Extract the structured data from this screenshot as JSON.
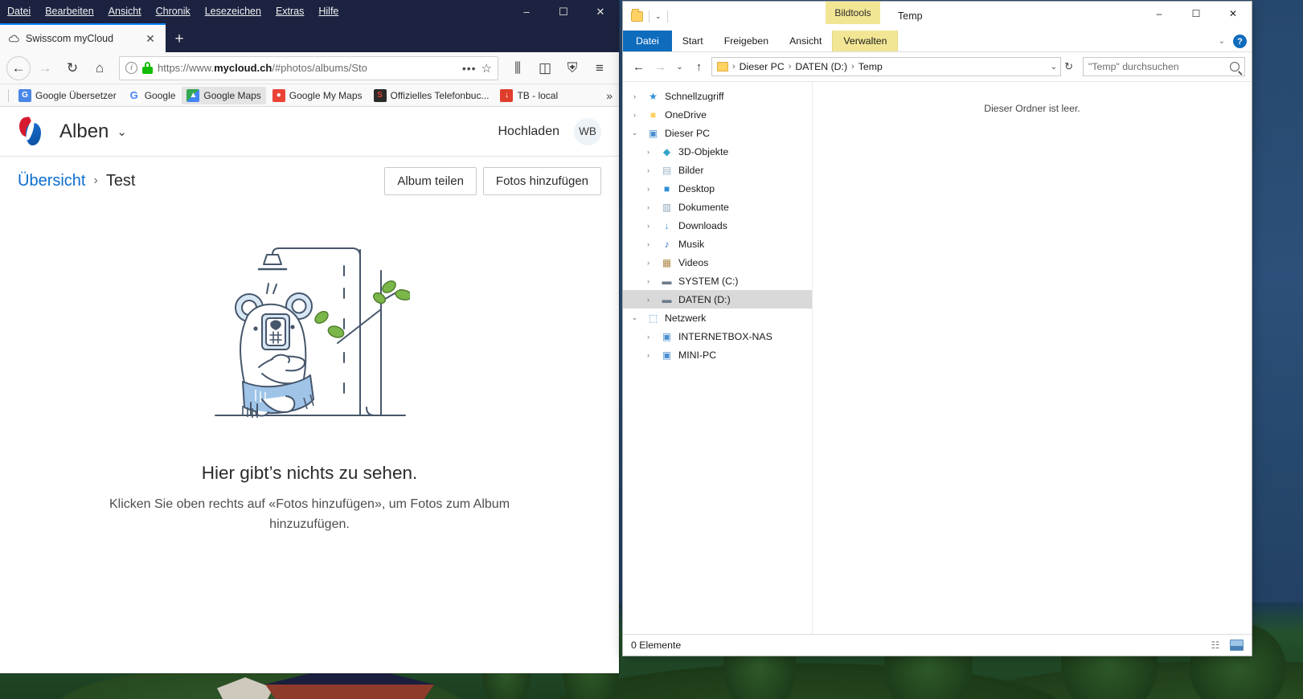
{
  "firefox": {
    "menubar": [
      "Datei",
      "Bearbeiten",
      "Ansicht",
      "Chronik",
      "Lesezeichen",
      "Extras",
      "Hilfe"
    ],
    "window_controls": {
      "minimize": "–",
      "maximize": "☐",
      "close": "✕"
    },
    "tab": {
      "title": "Swisscom myCloud",
      "close": "✕"
    },
    "new_tab": "+",
    "nav": {
      "back": "←",
      "forward": "→",
      "reload": "↻",
      "home": "⌂"
    },
    "urlbar": {
      "scheme": "https://www.",
      "domain": "mycloud.ch",
      "path": "/#photos/albums/Sto",
      "page_actions": "•••",
      "bookmark_star": "☆",
      "info_icon": "i"
    },
    "toolbar_icons": {
      "library": "⫼",
      "sidebar": "◫",
      "shield": "⛨",
      "menu": "≡"
    },
    "bookmarks": [
      {
        "label": "Google Übersetzer",
        "glyph": "G",
        "color": "#4a86e8",
        "active": false
      },
      {
        "label": "Google",
        "glyph": "G",
        "color": "#ffffff",
        "textcolor": "#4285f4",
        "active": false
      },
      {
        "label": "Google Maps",
        "glyph": "▲",
        "color": "#34a853",
        "active": true
      },
      {
        "label": "Google My Maps",
        "glyph": "●",
        "color": "#ea4335",
        "active": false
      },
      {
        "label": "Offizielles Telefonbuc...",
        "glyph": "S",
        "color": "#2b2b2b",
        "active": false
      },
      {
        "label": "TB - local",
        "glyph": "↓",
        "color": "#e03e2d",
        "active": false
      }
    ],
    "bookmarks_overflow": "»"
  },
  "mycloud": {
    "app_title": "Alben",
    "title_caret": "⌄",
    "upload_label": "Hochladen",
    "avatar_initials": "WB",
    "breadcrumb": {
      "root": "Übersicht",
      "separator": "›",
      "current": "Test"
    },
    "actions": {
      "share": "Album teilen",
      "add_photos": "Fotos hinzufügen"
    },
    "empty_state": {
      "title": "Hier gibt’s nichts zu sehen.",
      "description": "Klicken Sie oben rechts auf «Fotos hinzufügen», um Fotos zum Album hinzuzufügen."
    },
    "colors": {
      "link": "#0a6ed1",
      "logo_red": "#d6192e",
      "logo_blue": "#0b4f9e"
    }
  },
  "explorer": {
    "window_title": "Temp",
    "contextual_tab_group": "Bildtools",
    "window_controls": {
      "minimize": "–",
      "maximize": "☐",
      "close": "✕"
    },
    "quick_access": {
      "caret": "⌄"
    },
    "ribbon_tabs": [
      {
        "label": "Datei",
        "kind": "file"
      },
      {
        "label": "Start",
        "kind": "normal"
      },
      {
        "label": "Freigeben",
        "kind": "normal"
      },
      {
        "label": "Ansicht",
        "kind": "normal"
      },
      {
        "label": "Verwalten",
        "kind": "contextual"
      }
    ],
    "ribbon_right": {
      "collapse_caret": "⌄",
      "help": "?"
    },
    "address": {
      "back": "←",
      "forward": "→",
      "recent": "⌄",
      "up": "↑",
      "crumbs": [
        "Dieser PC",
        "DATEN (D:)",
        "Temp"
      ],
      "separator": "›",
      "dropdown": "⌄",
      "refresh": "↻"
    },
    "search": {
      "placeholder": "\"Temp\" durchsuchen"
    },
    "nav_tree": [
      {
        "label": "Schnellzugriff",
        "icon": "★",
        "color": "#2f8fd8",
        "indent": 0,
        "toggle": "›",
        "selected": false
      },
      {
        "label": "OneDrive",
        "icon": "■",
        "color": "#ffd264",
        "indent": 0,
        "toggle": "›",
        "selected": false
      },
      {
        "label": "Dieser PC",
        "icon": "▣",
        "color": "#4a8fd0",
        "indent": 0,
        "toggle": "⌄",
        "selected": false
      },
      {
        "label": "3D-Objekte",
        "icon": "◆",
        "color": "#37a3c9",
        "indent": 1,
        "toggle": "›",
        "selected": false
      },
      {
        "label": "Bilder",
        "icon": "▤",
        "color": "#9fb6c9",
        "indent": 1,
        "toggle": "›",
        "selected": false
      },
      {
        "label": "Desktop",
        "icon": "■",
        "color": "#2f8fd8",
        "indent": 1,
        "toggle": "›",
        "selected": false
      },
      {
        "label": "Dokumente",
        "icon": "▥",
        "color": "#8aa7bd",
        "indent": 1,
        "toggle": "›",
        "selected": false
      },
      {
        "label": "Downloads",
        "icon": "↓",
        "color": "#2f8fd8",
        "indent": 1,
        "toggle": "›",
        "selected": false
      },
      {
        "label": "Musik",
        "icon": "♪",
        "color": "#2f6fb8",
        "indent": 1,
        "toggle": "›",
        "selected": false
      },
      {
        "label": "Videos",
        "icon": "▦",
        "color": "#b08a4a",
        "indent": 1,
        "toggle": "›",
        "selected": false
      },
      {
        "label": "SYSTEM (C:)",
        "icon": "▬",
        "color": "#6b7b8a",
        "indent": 1,
        "toggle": "›",
        "selected": false
      },
      {
        "label": "DATEN (D:)",
        "icon": "▬",
        "color": "#6b7b8a",
        "indent": 1,
        "toggle": "›",
        "selected": true
      },
      {
        "label": "Netzwerk",
        "icon": "⬚",
        "color": "#4a8fd0",
        "indent": 0,
        "toggle": "⌄",
        "selected": false
      },
      {
        "label": "INTERNETBOX-NAS",
        "icon": "▣",
        "color": "#4a8fd0",
        "indent": 1,
        "toggle": "›",
        "selected": false
      },
      {
        "label": "MINI-PC",
        "icon": "▣",
        "color": "#4a8fd0",
        "indent": 1,
        "toggle": "›",
        "selected": false
      }
    ],
    "content_empty_message": "Dieser Ordner ist leer.",
    "status": {
      "item_count": "0 Elemente"
    },
    "view_toggles": {
      "details": "☷",
      "thumbnails": "thumbnail-view"
    }
  }
}
